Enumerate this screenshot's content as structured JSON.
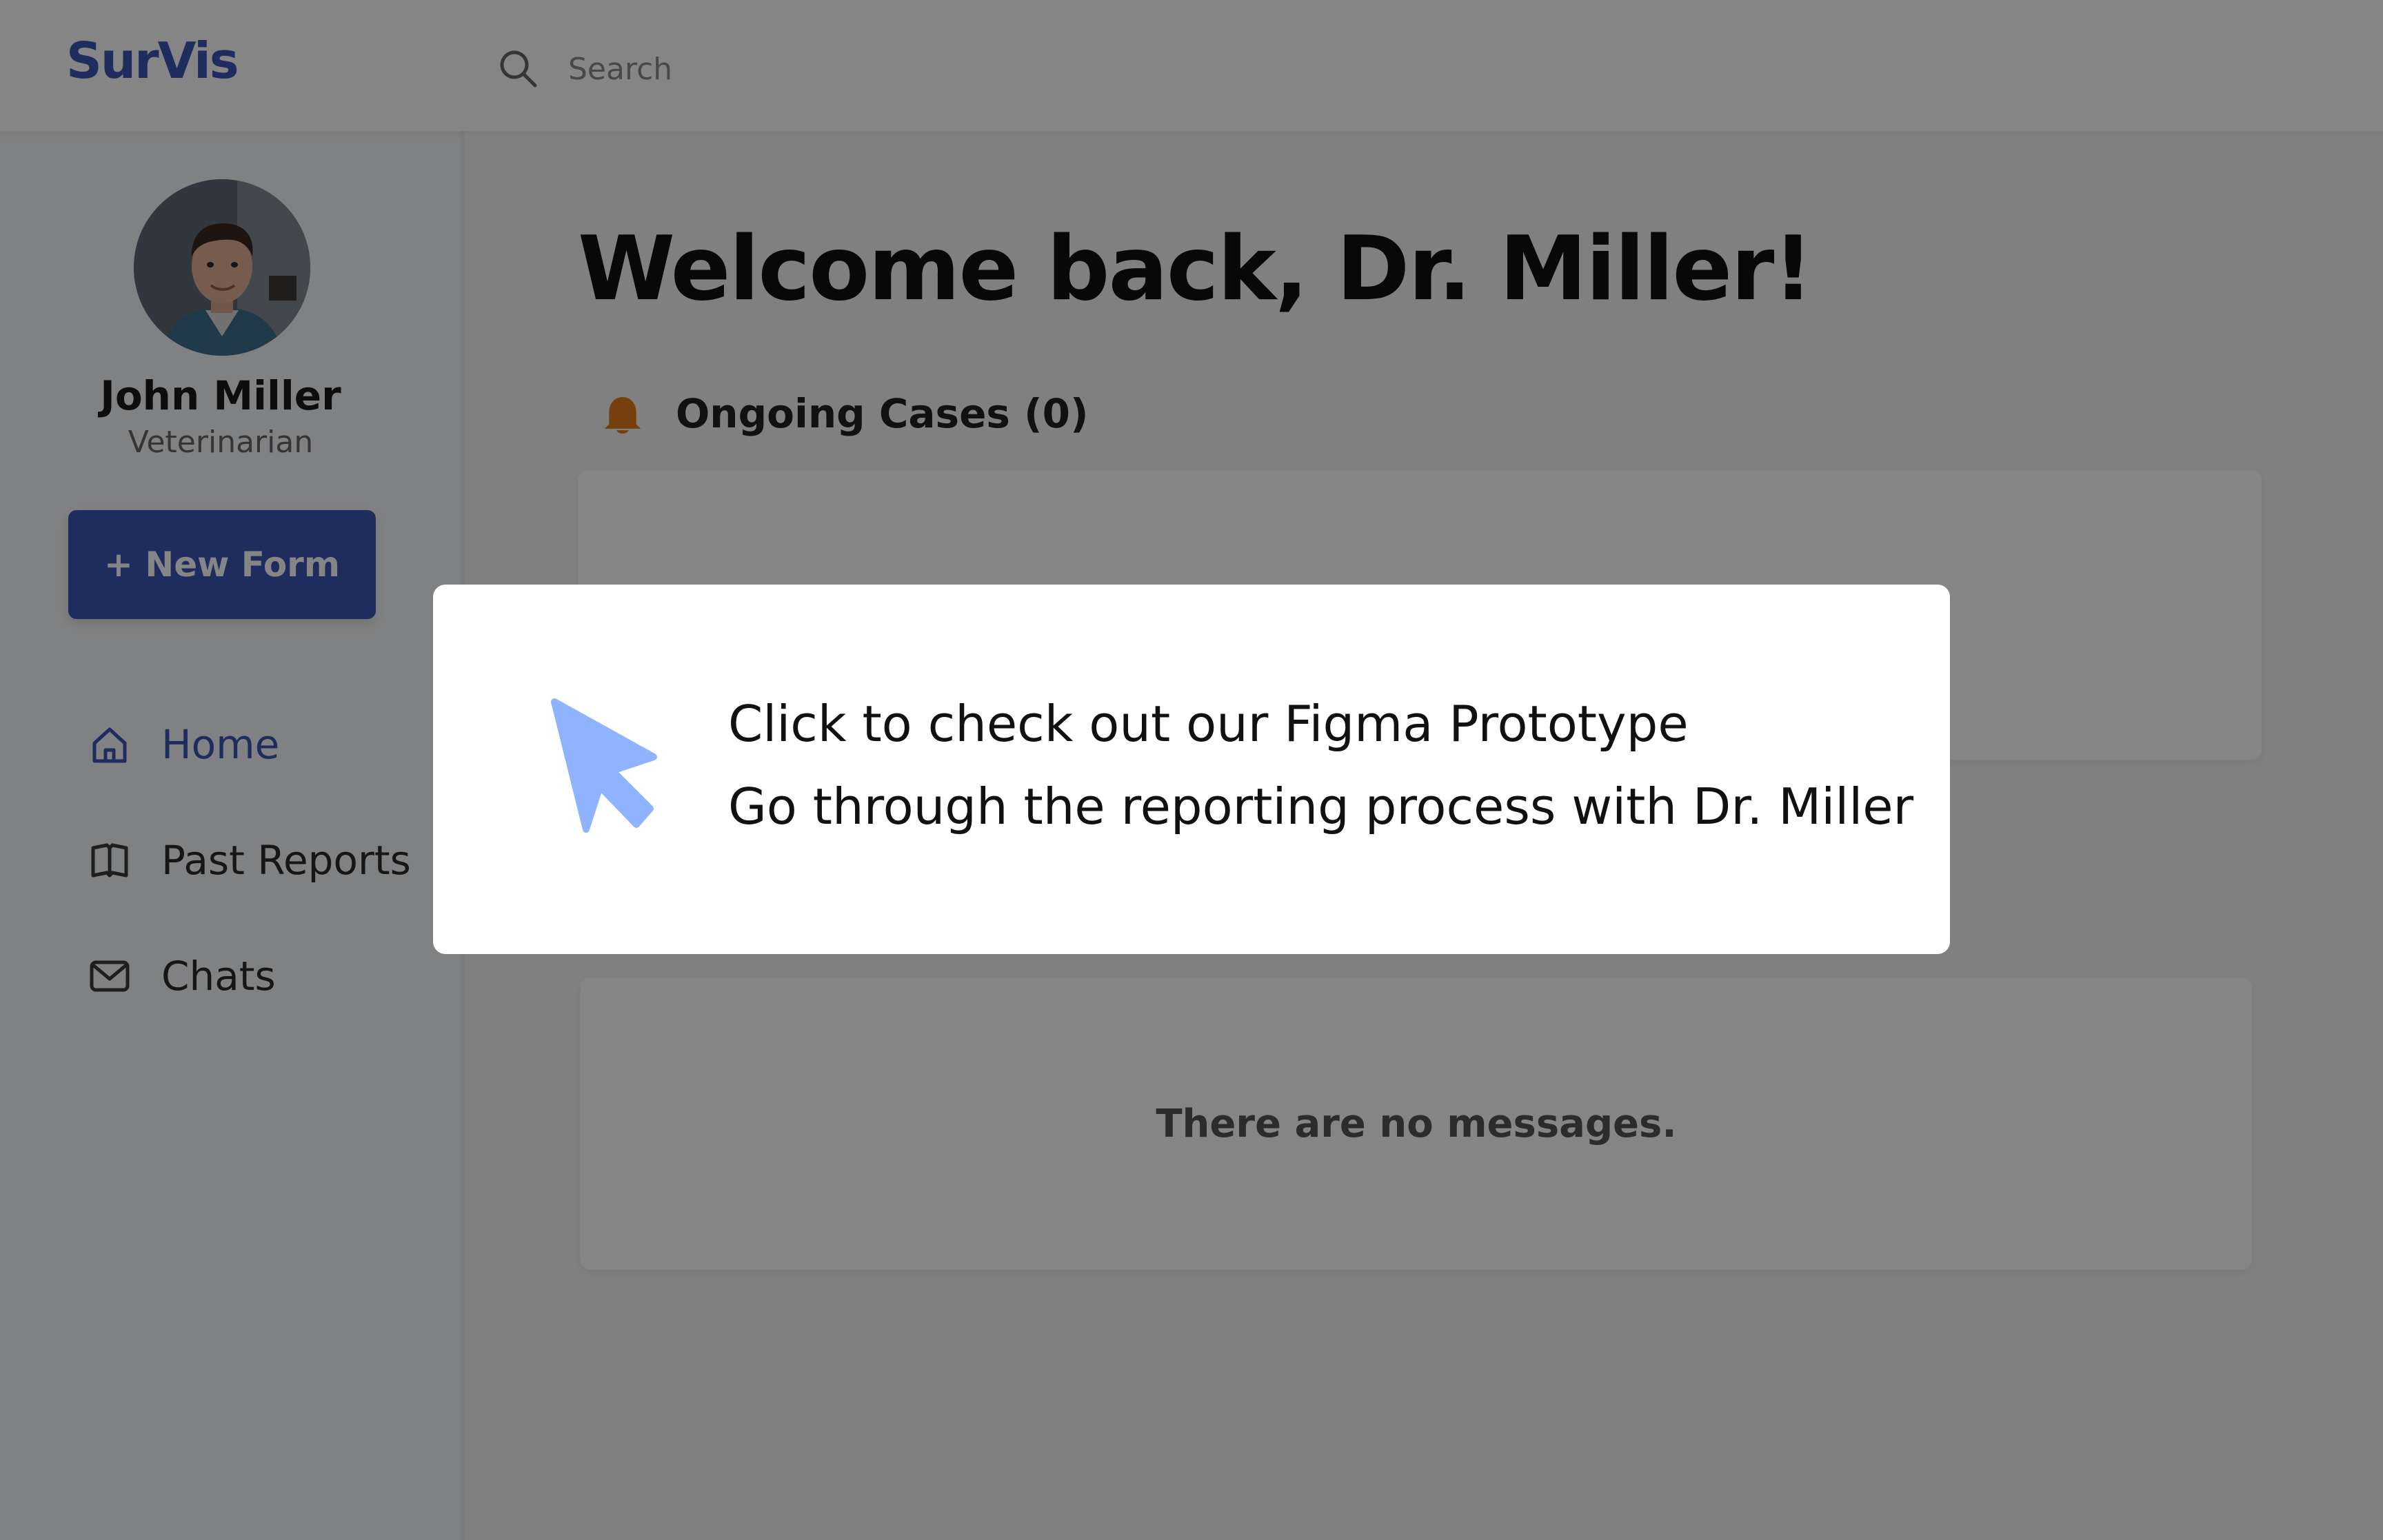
{
  "app": {
    "logo": "SurVis"
  },
  "search": {
    "placeholder": "Search"
  },
  "sidebar": {
    "user": {
      "name": "John Miller",
      "role": "Veterinarian"
    },
    "new_form_label": "+ New Form",
    "items": [
      {
        "label": "Home",
        "icon": "home-icon",
        "active": true
      },
      {
        "label": "Past Reports",
        "icon": "book-icon",
        "active": false
      },
      {
        "label": "Chats",
        "icon": "mail-icon",
        "active": false
      }
    ]
  },
  "main": {
    "welcome": "Welcome back, Dr. Miller!",
    "ongoing_title": "Ongoing Cases (0)",
    "messages_empty": "There are no messages."
  },
  "modal": {
    "line1": "Click to check out our Figma Prototype",
    "line2": "Go through the reporting process with Dr. Miller"
  },
  "colors": {
    "brand": "#3b55b5",
    "bell": "#e07b1a",
    "cursor": "#8fb3ff",
    "overlay": "rgba(0,0,0,0.48)"
  }
}
